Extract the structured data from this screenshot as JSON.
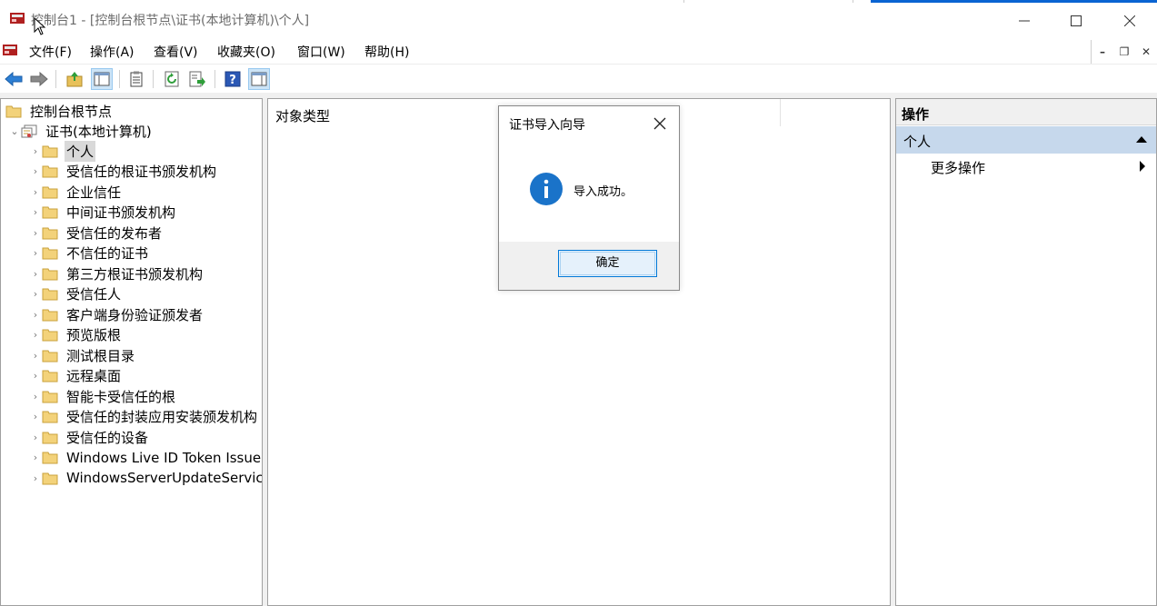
{
  "window": {
    "title": "控制台1 - [控制台根节点\\证书(本地计算机)\\个人]"
  },
  "menu": {
    "items": [
      "文件(F)",
      "操作(A)",
      "查看(V)",
      "收藏夹(O)",
      "窗口(W)",
      "帮助(H)"
    ]
  },
  "tree": {
    "root": "控制台根节点",
    "store": "证书(本地计算机)",
    "items": [
      "个人",
      "受信任的根证书颁发机构",
      "企业信任",
      "中间证书颁发机构",
      "受信任的发布者",
      "不信任的证书",
      "第三方根证书颁发机构",
      "受信任人",
      "客户端身份验证颁发者",
      "预览版根",
      "测试根目录",
      "远程桌面",
      "智能卡受信任的根",
      "受信任的封装应用安装颁发机构",
      "受信任的设备",
      "Windows Live ID Token Issuer",
      "WindowsServerUpdateServices"
    ],
    "selected_index": 0
  },
  "center": {
    "column_header": "对象类型"
  },
  "actions": {
    "title": "操作",
    "section": "个人",
    "more": "更多操作"
  },
  "dialog": {
    "title": "证书导入向导",
    "message": "导入成功。",
    "ok_label": "确定"
  },
  "colors": {
    "accent": "#0078d7",
    "section_bg": "#c6d8ec",
    "info_icon": "#1a73c9",
    "folder": "#f3d27a"
  }
}
